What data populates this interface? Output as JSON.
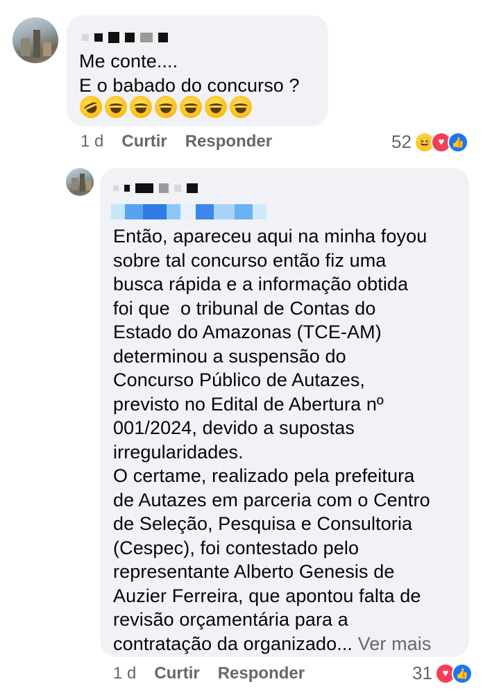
{
  "comment1": {
    "text": "Me conte....\nE o babado do concurso ?",
    "emojis": [
      "rolling-on-floor-laughing",
      "face-with-tears-of-joy",
      "face-with-tears-of-joy",
      "face-with-tears-of-joy",
      "face-with-tears-of-joy",
      "face-with-tears-of-joy",
      "face-with-tears-of-joy"
    ],
    "time": "1 d",
    "like_label": "Curtir",
    "reply_label": "Responder",
    "reaction_count": "52",
    "reactions": [
      "haha-icon",
      "love-icon",
      "like-icon"
    ]
  },
  "comment2": {
    "text": "Então, apareceu aqui na minha foyou\nsobre tal concurso então fiz uma\nbusca rápida e a informação obtida\nfoi que  o tribunal de Contas do\nEstado do Amazonas (TCE-AM)\ndeterminou a suspensão do\nConcurso Público de Autazes,\nprevisto no Edital de Abertura nº\n001/2024, devido a supostas\nirregularidades.\nO certame, realizado pela prefeitura\nde Autazes em parceria com o Centro\nde Seleção, Pesquisa e Consultoria\n(Cespec), foi contestado pelo\nrepresentante Alberto Genesis de\nAuzier Ferreira, que apontou falta de\nrevisão orçamentária para a\ncontratação da organizado...",
    "see_more": "Ver mais",
    "time": "1 d",
    "like_label": "Curtir",
    "reply_label": "Responder",
    "reaction_count": "31",
    "reactions": [
      "love-icon",
      "like-icon"
    ]
  },
  "colors": {
    "bubble": "#f0f2f5",
    "meta": "#65676b",
    "text": "#050505",
    "like": "#1877f2",
    "love": "#f33e58"
  }
}
